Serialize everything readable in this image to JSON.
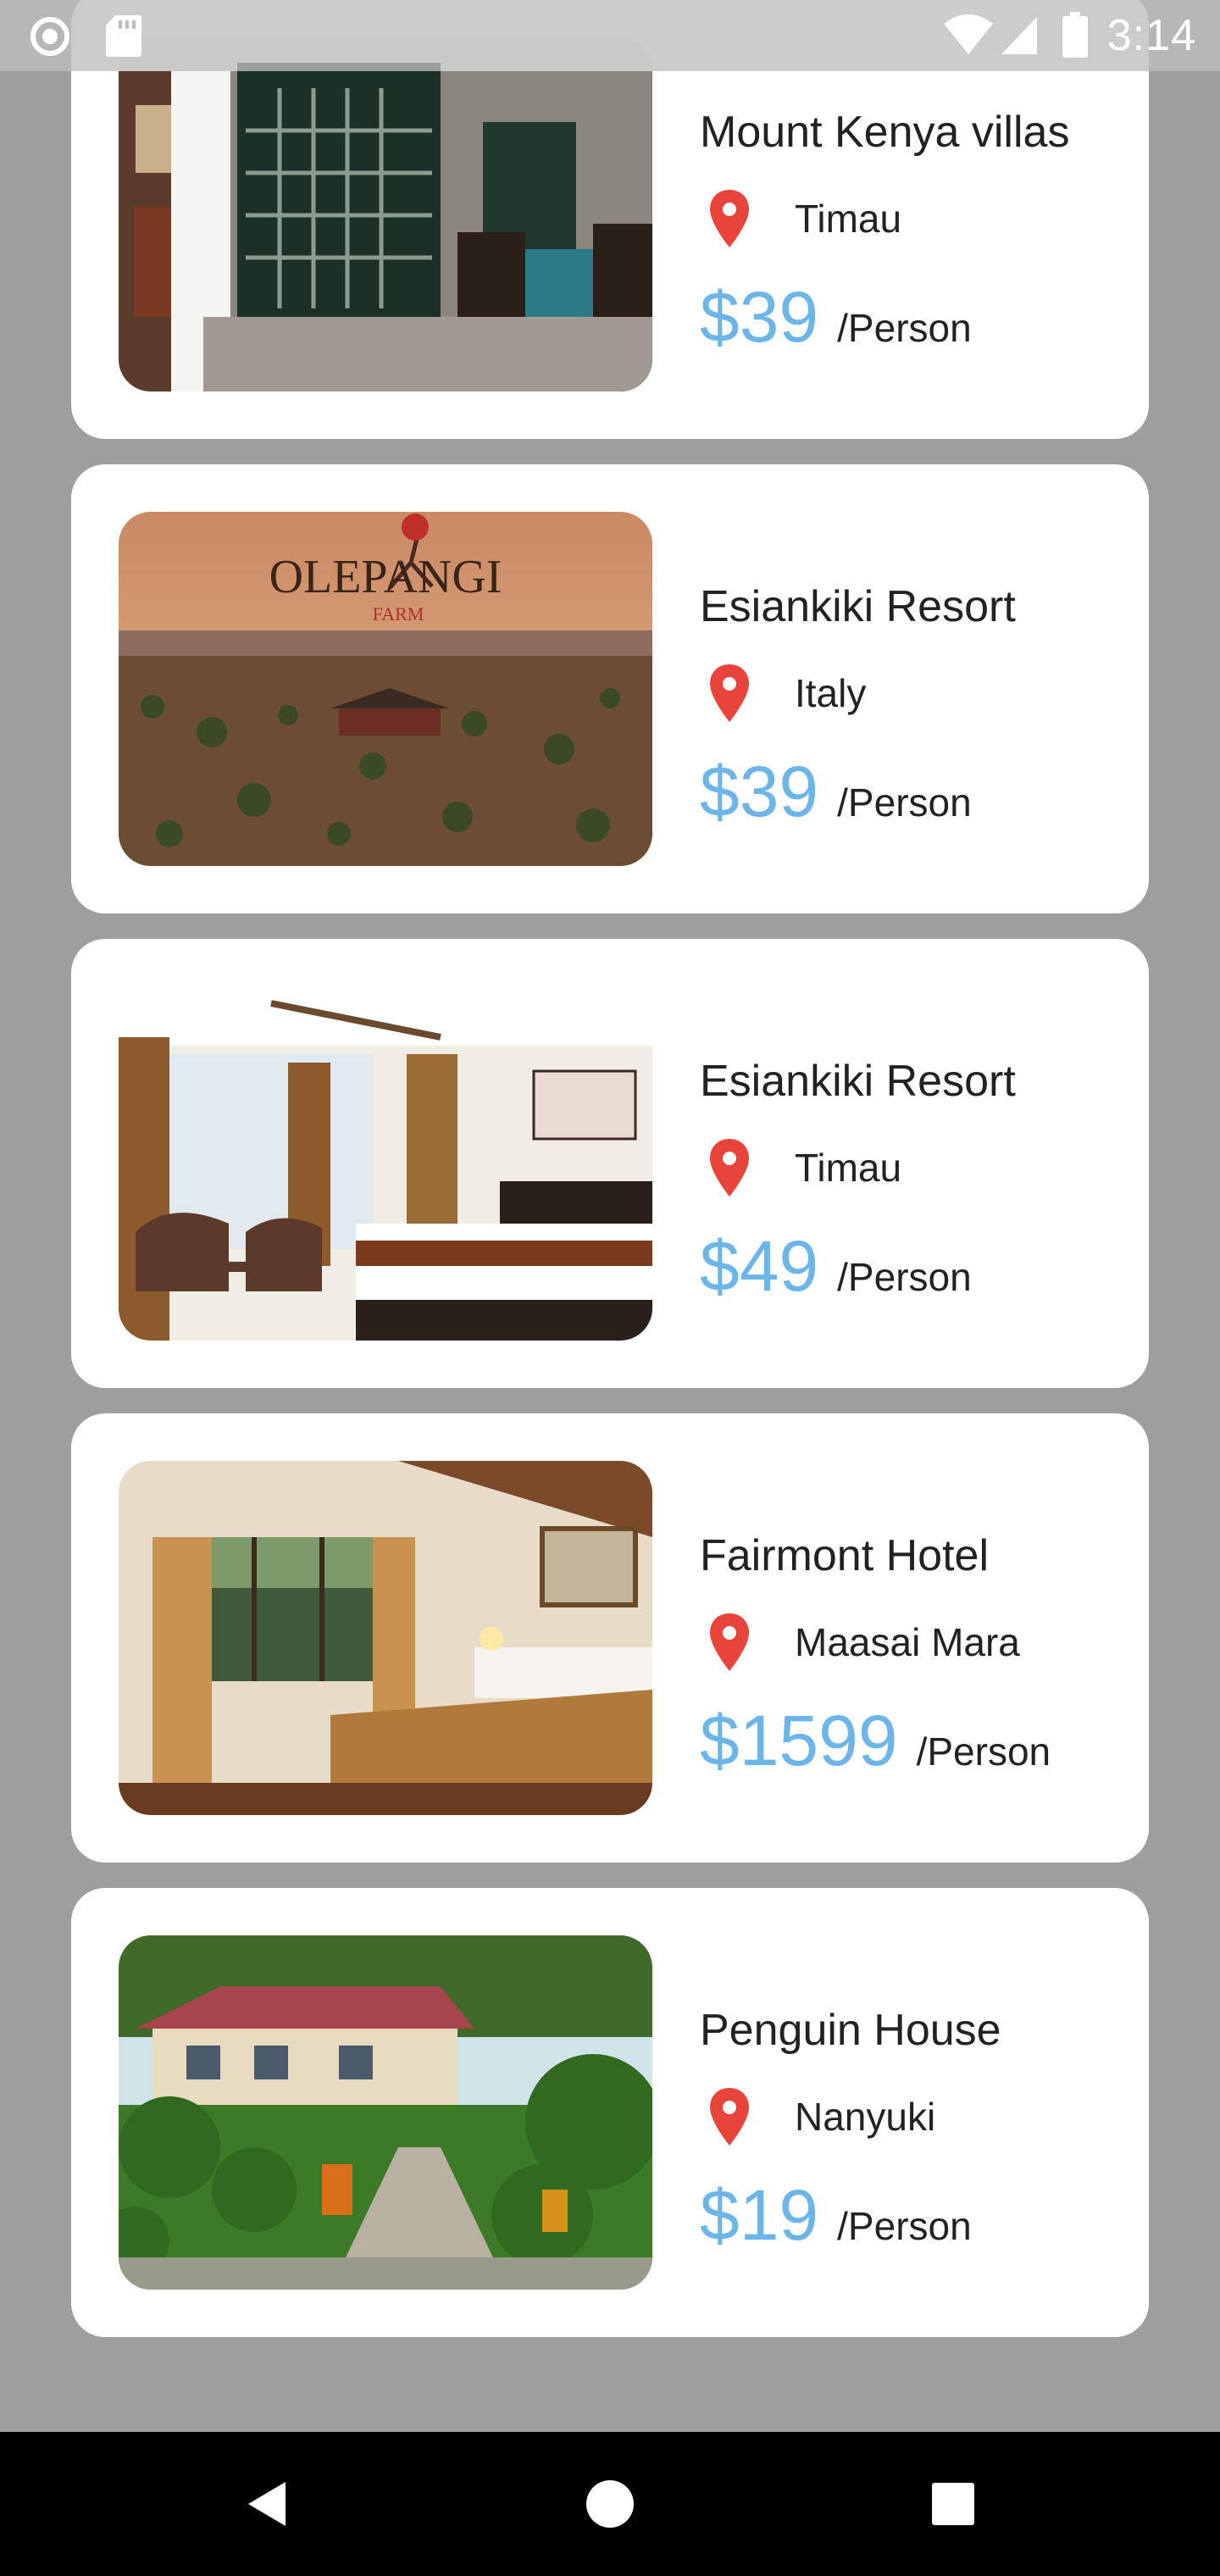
{
  "status_bar": {
    "time": "3:14",
    "icons": [
      "record-icon",
      "sd-card-icon",
      "wifi-icon",
      "signal-icon",
      "battery-icon"
    ]
  },
  "hotels": [
    {
      "name": "Mount Kenya villas",
      "location": "Timau",
      "price": "$39",
      "unit": "/Person",
      "photo": "villa-interior-photo"
    },
    {
      "name": "Esiankiki Resort",
      "location": "Italy",
      "price": "$39",
      "unit": "/Person",
      "photo": "olepangi-farm-photo",
      "photo_text": "OLEPANGI",
      "photo_subtext": "FARM"
    },
    {
      "name": "Esiankiki Resort",
      "location": "Timau",
      "price": "$49",
      "unit": "/Person",
      "photo": "bedroom-photo"
    },
    {
      "name": "Fairmont Hotel",
      "location": "Maasai Mara",
      "price": "$1599",
      "unit": "/Person",
      "photo": "lodge-bedroom-photo"
    },
    {
      "name": "Penguin House",
      "location": "Nanyuki",
      "price": "$19",
      "unit": "/Person",
      "photo": "garden-cottage-photo"
    }
  ],
  "colors": {
    "background": "#9e9e9e",
    "card": "#ffffff",
    "price": "#6bb5e8",
    "pin": "#e8443a",
    "nav_bar": "#000000"
  },
  "nav_bar": {
    "buttons": [
      "back-icon",
      "home-icon",
      "recents-icon"
    ]
  }
}
